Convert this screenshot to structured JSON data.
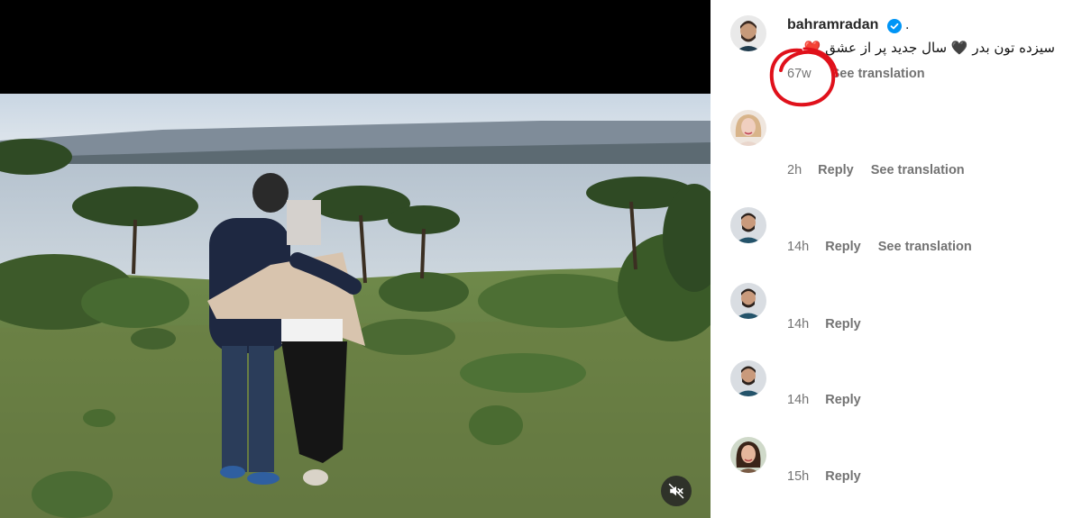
{
  "post": {
    "username": "bahramradan",
    "after_badge": ".",
    "caption": "سیزده تون بدر 🖤 سال جدید پر از عشق ❤️",
    "time": "67w",
    "see_translation": "See translation",
    "verified_color": "#0095f6"
  },
  "comments": [
    {
      "time": "2h",
      "reply": "Reply",
      "see_translation": "See translation",
      "avatar": "woman-with-blonde-hair"
    },
    {
      "time": "14h",
      "reply": "Reply",
      "see_translation": "See translation",
      "avatar": "bahramradan"
    },
    {
      "time": "14h",
      "reply": "Reply",
      "avatar": "bahramradan"
    },
    {
      "time": "14h",
      "reply": "Reply",
      "avatar": "bahramradan"
    },
    {
      "time": "15h",
      "reply": "Reply",
      "avatar": "woman-with-dark-hair"
    }
  ],
  "media": {
    "mute_icon": "speaker-muted-icon"
  },
  "annotation": {
    "color": "#e0111b"
  },
  "colors": {
    "secondary_text": "#737373",
    "primary_text": "#262626"
  }
}
